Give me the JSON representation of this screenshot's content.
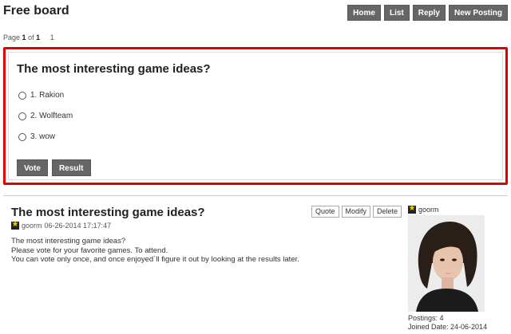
{
  "board": {
    "title": "Free board"
  },
  "top_buttons": [
    "Home",
    "List",
    "Reply",
    "New Posting"
  ],
  "pager": {
    "prefix": "Page",
    "current": "1",
    "of_label": "of",
    "total": "1",
    "page_link": "1"
  },
  "poll": {
    "question": "The most interesting game ideas?",
    "options": [
      "1. Rakion",
      "2. Wolfteam",
      "3. wow"
    ],
    "vote_label": "Vote",
    "result_label": "Result",
    "highlight_color": "#e00000"
  },
  "post": {
    "title": "The most interesting game ideas?",
    "author": "goorm",
    "date": "06-26-2014 17:17:47",
    "body": [
      "The most interesting game ideas?",
      "Please vote for your favorite games. To attend.",
      "You can vote only once, and once enjoyed`ll figure it out by looking at the results later."
    ],
    "actions": [
      "Quote",
      "Modify",
      "Delete"
    ]
  },
  "profile": {
    "name": "goorm",
    "postings": "Postings: 4",
    "joined": "Joined Date: 24-06-2014"
  }
}
